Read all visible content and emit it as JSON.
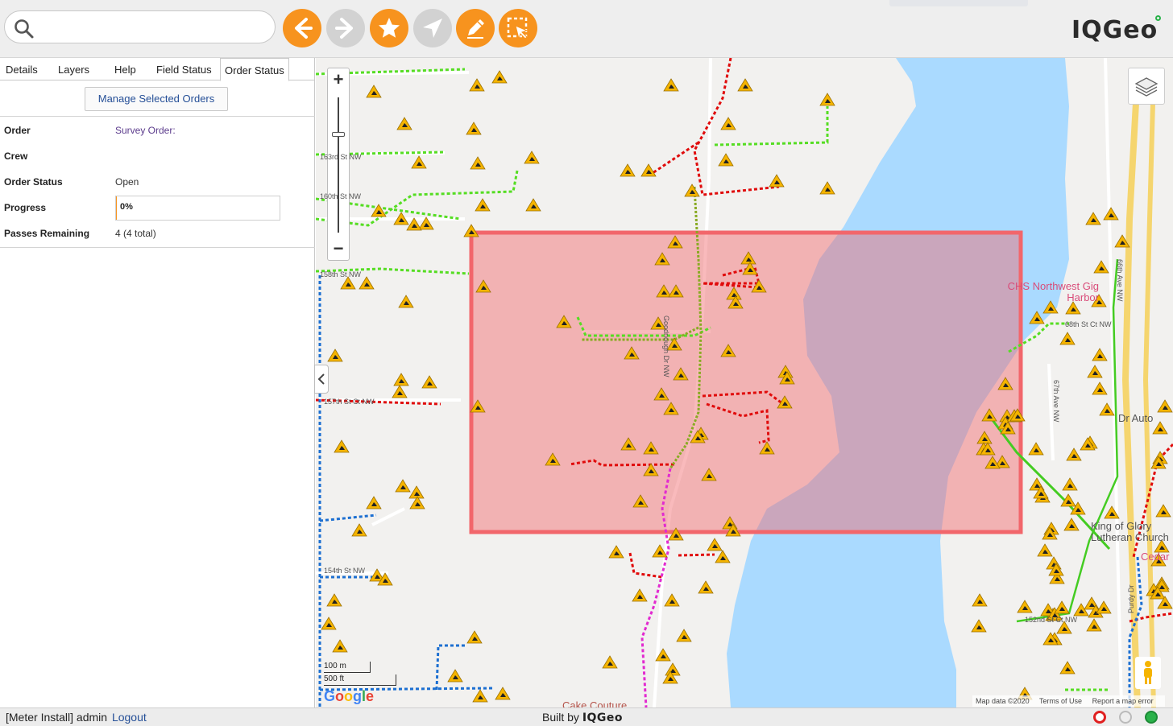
{
  "search": {
    "placeholder": "",
    "value": ""
  },
  "toolbar": {
    "buttons": [
      {
        "name": "back-button",
        "icon": "arrow-left-icon",
        "enabled": true
      },
      {
        "name": "forward-button",
        "icon": "arrow-right-icon",
        "enabled": false
      },
      {
        "name": "bookmark-button",
        "icon": "star-icon",
        "enabled": true
      },
      {
        "name": "navigate-button",
        "icon": "send-icon",
        "enabled": false
      },
      {
        "name": "edit-button",
        "icon": "pencil-icon",
        "enabled": true
      },
      {
        "name": "select-area-button",
        "icon": "select-arrow-icon",
        "enabled": true
      }
    ],
    "accent": "#f7931e"
  },
  "brand": {
    "logo": "IQGeo"
  },
  "tabs": [
    "Details",
    "Layers",
    "Help",
    "Field Status",
    "Order Status"
  ],
  "active_tab": "Order Status",
  "order_panel": {
    "manage_button": "Manage Selected Orders",
    "rows": {
      "order": {
        "label": "Order",
        "value": "Survey Order:"
      },
      "crew": {
        "label": "Crew",
        "value": ""
      },
      "status": {
        "label": "Order Status",
        "value": "Open"
      },
      "progress": {
        "label": "Progress",
        "value": "0%",
        "fraction": 0
      },
      "passes": {
        "label": "Passes Remaining",
        "value": "4 (4 total)"
      }
    }
  },
  "map": {
    "zoom_in": "+",
    "zoom_out": "−",
    "street_labels": [
      "163rd St NW",
      "160th St NW",
      "158th St NW",
      "157th St Ct NW",
      "154th St NW",
      "Goodnough Dr NW",
      "66th Ave NW",
      "67th Ave NW",
      "68th St Ct NW",
      "152nd St Ct NW",
      "Purdy Dr"
    ],
    "pois": [
      "CHS Northwest Gig Harbor",
      "Dr Auto",
      "King of Glory Lutheran Church",
      "Cedar Mo",
      "Cake Couture"
    ],
    "scale": {
      "metric": "100 m",
      "imperial": "500 ft"
    },
    "google": "Google",
    "attribution": [
      "Map data ©2020",
      "Terms of Use",
      "Report a map error"
    ],
    "selection_color": "#f2666b",
    "water_color": "#aadaff"
  },
  "statusbar": {
    "user_text": "[Meter Install] admin",
    "logout": "Logout",
    "built_by": "Built by",
    "built_logo": "IQGeo"
  }
}
